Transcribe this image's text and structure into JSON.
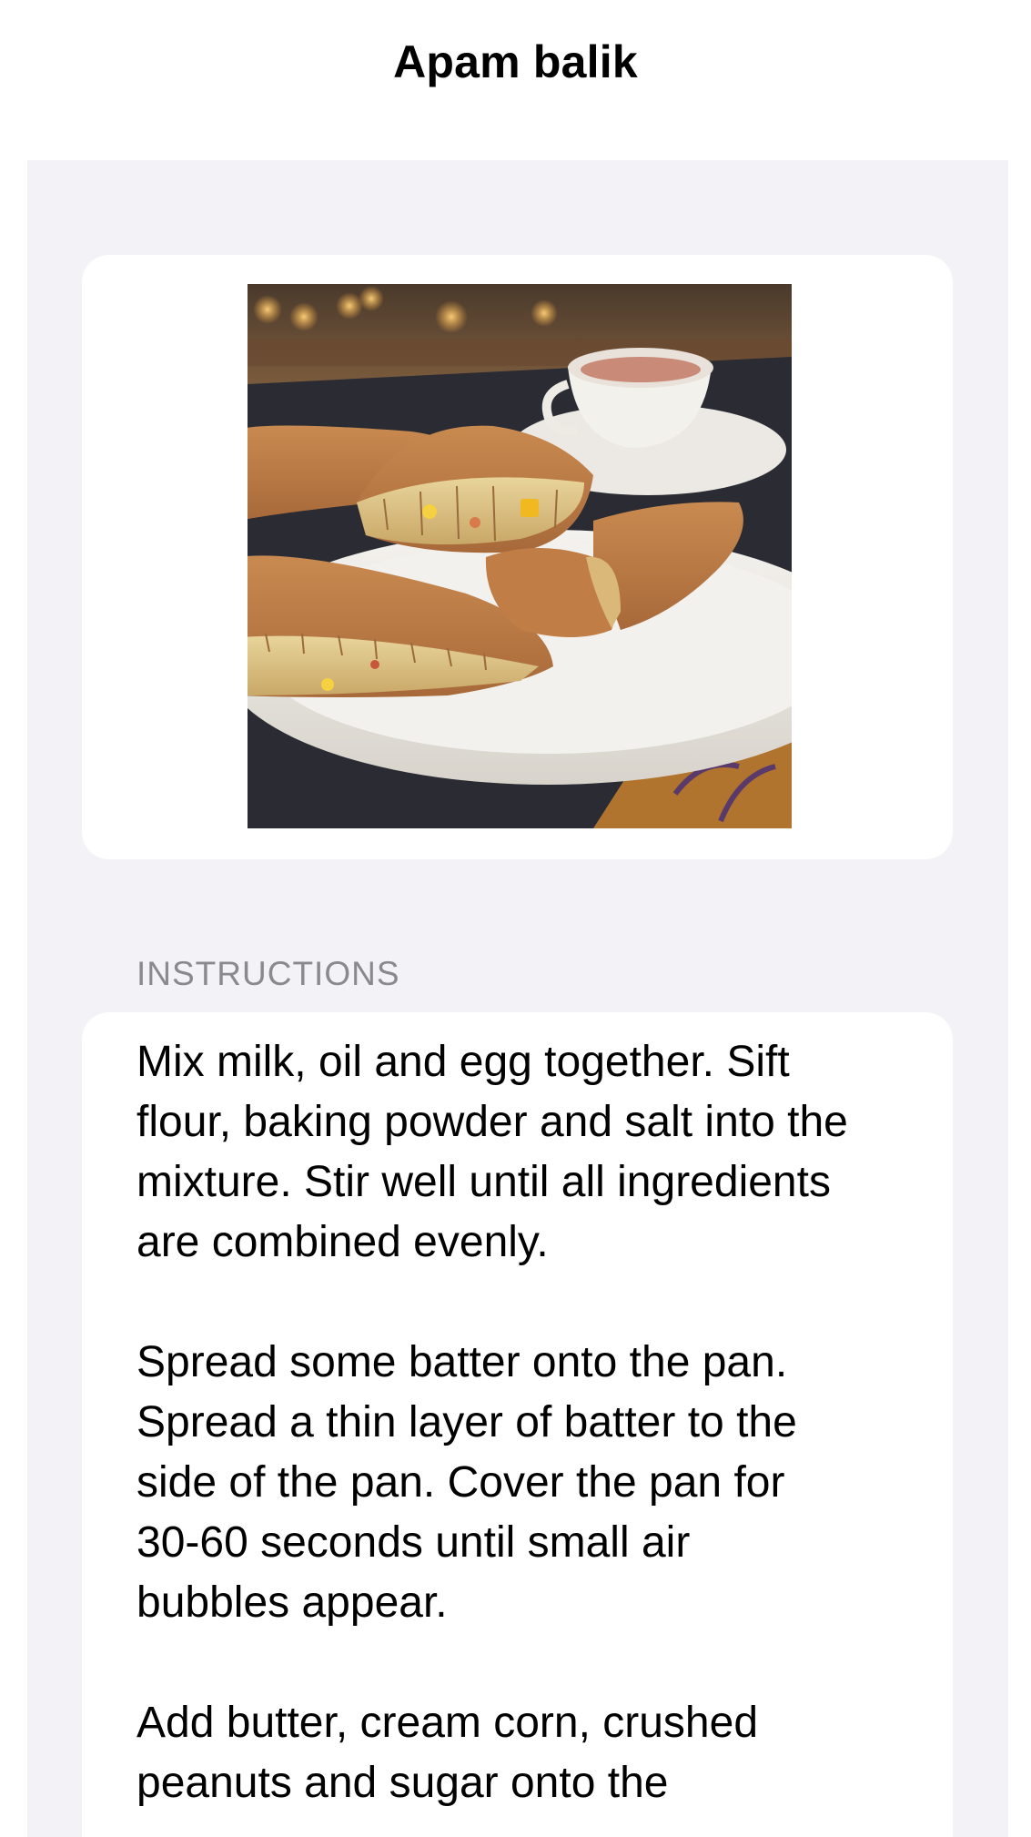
{
  "nav": {
    "title": "Apam balik"
  },
  "photo": {
    "alt": "Apam balik"
  },
  "instructions": {
    "header": "INSTRUCTIONS",
    "text": "Mix milk, oil and egg together. Sift\nflour, baking powder and salt into the\nmixture. Stir well until all ingredients\nare combined evenly.\n\nSpread some batter onto the pan.\nSpread a thin layer of batter to the\nside of the pan. Cover the pan for\n30-60 seconds until small air\nbubbles appear.\n\nAdd butter, cream corn, crushed\npeanuts and sugar onto the"
  },
  "colors": {
    "group_background": "#f2f2f7",
    "card_background": "#ffffff",
    "section_header": "#8a8a8e"
  }
}
